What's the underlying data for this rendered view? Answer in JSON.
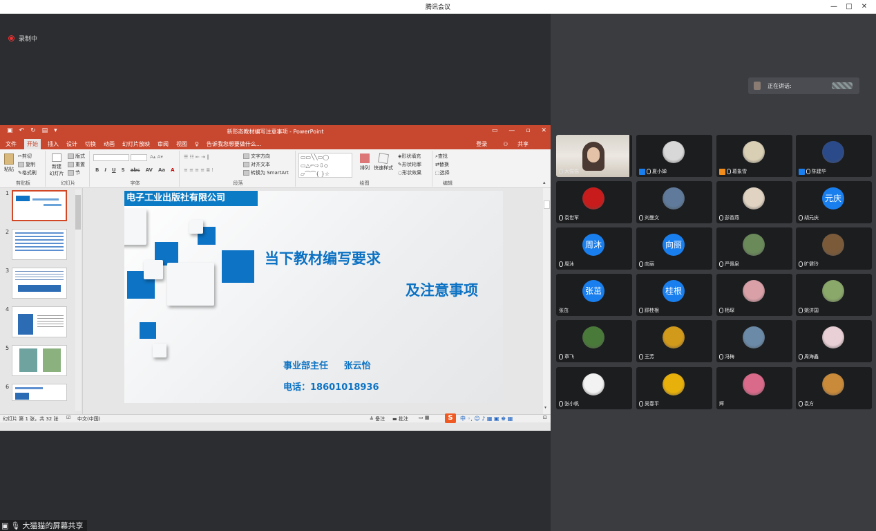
{
  "window": {
    "title": "腾讯会议",
    "controls": [
      "—",
      "□",
      "✕"
    ]
  },
  "recording": {
    "label": "录制中"
  },
  "sharer_label": "大猫猫的屏幕共享",
  "ppt": {
    "title": "新形态教材编写注意事项 - PowerPoint",
    "tabs": [
      "文件",
      "开始",
      "插入",
      "设计",
      "切换",
      "动画",
      "幻灯片放映",
      "审阅",
      "视图"
    ],
    "tell_me": "告诉我您想要做什么...",
    "login": "登录",
    "share": "共享",
    "ribbon": {
      "clipboard": {
        "paste": "粘贴",
        "cut": "剪切",
        "copy": "复制",
        "format": "格式刷",
        "label": "剪贴板"
      },
      "slides": {
        "new": "新建",
        "new2": "幻灯片",
        "layout": "版式",
        "reset": "重置",
        "section": "节",
        "label": "幻灯片"
      },
      "font": {
        "bold": "B",
        "italic": "I",
        "underline": "U",
        "shadow": "S",
        "strike": "abc",
        "spacing": "AV",
        "case": "Aa",
        "label": "字体"
      },
      "paragraph": {
        "dir": "文字方向",
        "align": "对齐文本",
        "smartart": "转换为 SmartArt",
        "label": "段落"
      },
      "drawing": {
        "arrange": "排列",
        "styles": "快速样式",
        "fill": "形状填充",
        "outline": "形状轮廓",
        "effect": "形状效果",
        "label": "绘图"
      },
      "editing": {
        "find": "查找",
        "replace": "替换",
        "select": "选择",
        "label": "编辑"
      }
    },
    "thumbnails": [
      "1",
      "2",
      "3",
      "4",
      "5",
      "6"
    ],
    "slide": {
      "company": "电子工业出版社有限公司",
      "title1": "当下教材编写要求",
      "title2": "及注意事项",
      "role_line": "事业部主任     张云怡",
      "phone_line": "电话：18601018936"
    },
    "status": {
      "slide_info": "幻灯片 第 1 张，共 32 张",
      "lang": "中文(中国)",
      "notes": "备注",
      "comments": "批注"
    }
  },
  "panel": {
    "speaking_label": "正在讲话:",
    "participants": [
      {
        "name": "大猫猫",
        "type": "video"
      },
      {
        "name": "夏小婵",
        "type": "photo",
        "badge": "host",
        "color": "#d8d8d8"
      },
      {
        "name": "葛象雪",
        "type": "photo",
        "badge": "cohost",
        "color": "#d9cfb5"
      },
      {
        "name": "陈建华",
        "type": "photo",
        "badge": "host",
        "color": "#2a4a8a"
      },
      {
        "name": "袁世军",
        "type": "photo",
        "color": "#c81b1b"
      },
      {
        "name": "刘曼文",
        "type": "photo",
        "color": "#5f7a9a"
      },
      {
        "name": "彭香燕",
        "type": "photo",
        "color": "#e0d3c2"
      },
      {
        "name": "胡元庆",
        "type": "text",
        "avatar_text": "元庆"
      },
      {
        "name": "周沐",
        "type": "text",
        "avatar_text": "周沐"
      },
      {
        "name": "向丽",
        "type": "text",
        "avatar_text": "向丽"
      },
      {
        "name": "严佩泉",
        "type": "photo",
        "color": "#6a8a5a"
      },
      {
        "name": "旷健玲",
        "type": "photo",
        "color": "#7b5a3a"
      },
      {
        "name": "张茁",
        "type": "text",
        "avatar_text": "张茁",
        "nomic": true
      },
      {
        "name": "顾桂根",
        "type": "text",
        "avatar_text": "桂根"
      },
      {
        "name": "杨琛",
        "type": "photo",
        "color": "#d9a0a8"
      },
      {
        "name": "姚济国",
        "type": "photo",
        "color": "#8aa86a"
      },
      {
        "name": "章飞",
        "type": "photo",
        "color": "#4a7a3a"
      },
      {
        "name": "王芳",
        "type": "photo",
        "color": "#d29a1a"
      },
      {
        "name": "冯梅",
        "type": "photo",
        "color": "#6a8aa8"
      },
      {
        "name": "周海鑫",
        "type": "photo",
        "color": "#e8d0d6"
      },
      {
        "name": "张小帆",
        "type": "photo",
        "color": "#f2f2f2"
      },
      {
        "name": "吴春平",
        "type": "photo",
        "color": "#e8b00a"
      },
      {
        "name": "辉",
        "type": "photo",
        "color": "#d96a8a",
        "nomic": true
      },
      {
        "name": "袁方",
        "type": "photo",
        "color": "#c98a3a"
      }
    ]
  }
}
